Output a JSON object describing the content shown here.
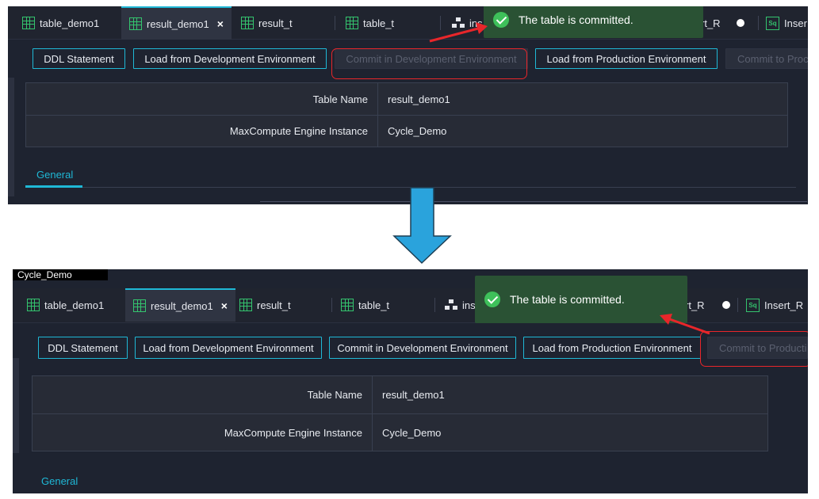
{
  "tabs": [
    "table_demo1",
    "result_demo1",
    "result_t",
    "table_t",
    "insert_R",
    "Insert_R"
  ],
  "tabs_visible": {
    "top": {
      "ins": "ins",
      "rt": "rt_R",
      "sq": "Inser"
    },
    "bottom": {
      "ins": "ins",
      "rt": "rt_R",
      "sq": "Insert_R"
    }
  },
  "close_glyph": "×",
  "sq_icon_text": "Sq",
  "buttons": {
    "ddl": "DDL Statement",
    "load_dev": "Load from Development Environment",
    "commit_dev": "Commit in Development Environment",
    "load_prod": "Load from Production Environment",
    "commit_prod_top": "Commit to Proc",
    "commit_prod_bottom": "Commit to Producti"
  },
  "table": {
    "rows": [
      {
        "label": "Table Name",
        "value": "result_demo1"
      },
      {
        "label": "MaxCompute Engine Instance",
        "value": "Cycle_Demo"
      }
    ]
  },
  "general_tab": "General",
  "toast": {
    "message": "The table is committed."
  },
  "window_title": "Cycle_Demo",
  "colors": {
    "accent": "#1fb8d6",
    "panel_bg": "#1e2330",
    "toast_bg": "#2a5234",
    "highlight": "#e8262a",
    "arrow": "#2aa3dc",
    "icon_green": "#34c46e"
  },
  "icons": [
    "table-icon",
    "close-icon",
    "tree-icon",
    "dot-icon",
    "sq-icon",
    "check-circle-icon",
    "arrow-down-icon"
  ]
}
